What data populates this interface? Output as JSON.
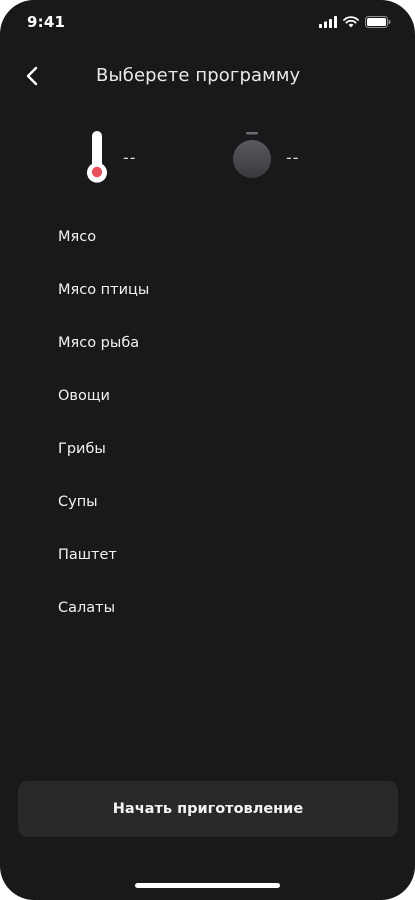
{
  "status_bar": {
    "time": "9:41"
  },
  "header": {
    "title": "Выберете программу"
  },
  "indicators": {
    "temperature_value": "--",
    "timer_value": "--"
  },
  "programs": [
    {
      "label": "Мясо"
    },
    {
      "label": "Мясо птицы"
    },
    {
      "label": "Мясо рыба"
    },
    {
      "label": "Овощи"
    },
    {
      "label": "Грибы"
    },
    {
      "label": "Супы"
    },
    {
      "label": "Паштет"
    },
    {
      "label": "Салаты"
    }
  ],
  "start_button": {
    "label": "Начать приготовление"
  },
  "colors": {
    "background": "#19191b",
    "button": "#29292c",
    "thermometer_accent": "#e8505b"
  },
  "icons": [
    "cellular-signal-icon",
    "wifi-icon",
    "battery-icon",
    "back-arrow-icon",
    "thermometer-icon",
    "timer-knob-icon"
  ]
}
